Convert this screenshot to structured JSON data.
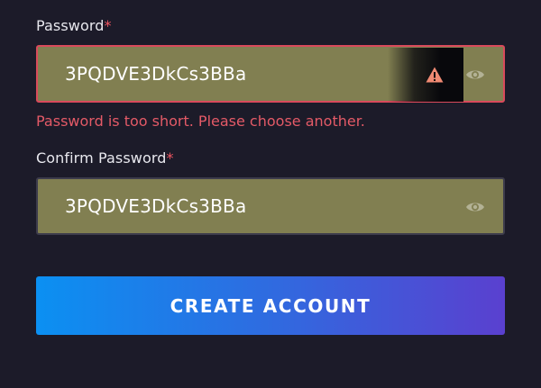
{
  "password": {
    "label": "Password",
    "required_mark": "*",
    "value": "3PQDVE3DkCs3BBa",
    "error": "Password is too short. Please choose another."
  },
  "confirm_password": {
    "label": "Confirm Password",
    "required_mark": "*",
    "value": "3PQDVE3DkCs3BBa"
  },
  "submit": {
    "label": "CREATE ACCOUNT"
  },
  "icons": {
    "toggle_visibility": "eye-icon",
    "autofill_warning": "warning-triangle-icon"
  },
  "colors": {
    "background": "#1c1b29",
    "field_fill": "#817f51",
    "error": "#e45a67",
    "required": "#ef5661",
    "button_start": "#0b90f2",
    "button_end": "#5a40cf"
  }
}
